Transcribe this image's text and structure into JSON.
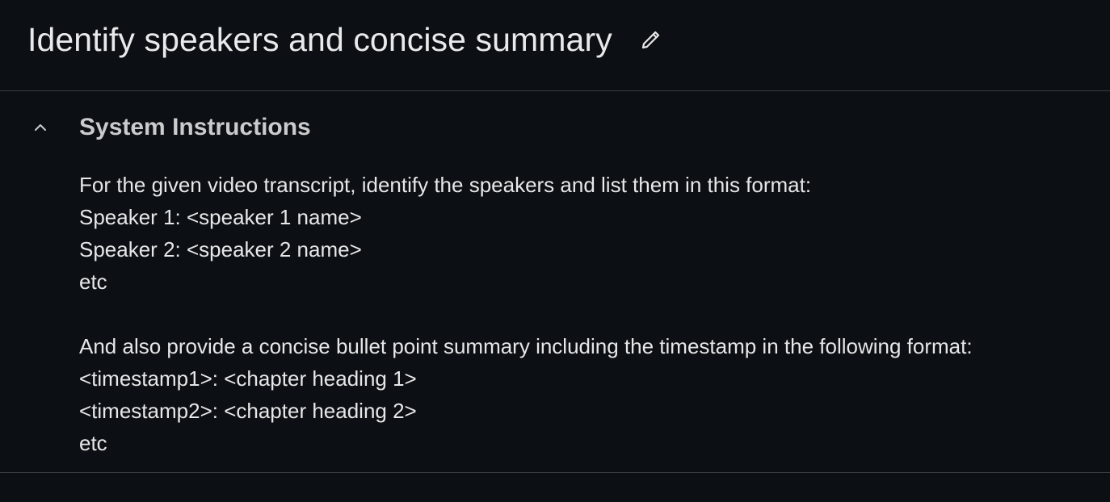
{
  "header": {
    "title": "Identify speakers and concise summary",
    "edit_icon": "pencil-icon"
  },
  "system_instructions": {
    "label": "System Instructions",
    "toggle_icon": "chevron-up-icon",
    "expanded": true,
    "text": "For the given video transcript, identify the speakers and list them in this format:\nSpeaker 1: <speaker 1 name>\nSpeaker 2: <speaker 2 name>\netc\n\nAnd also provide a concise bullet point summary including the timestamp in the following format:\n<timestamp1>: <chapter heading 1>\n<timestamp2>: <chapter heading 2>\netc"
  },
  "colors": {
    "background": "#0c0f13",
    "divider": "#3a3d42",
    "text": "#e6e7e8",
    "muted_text": "#c9cbcd"
  }
}
